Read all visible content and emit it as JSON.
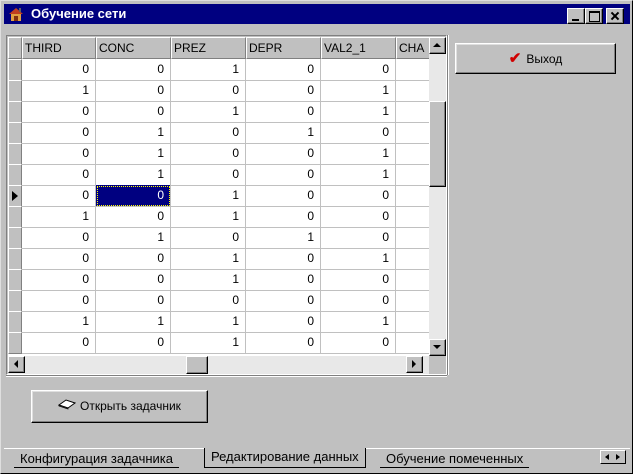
{
  "window": {
    "title": "Обучение сети"
  },
  "grid": {
    "columns": [
      "THIRD",
      "CONC",
      "PREZ",
      "DEPR",
      "VAL2_1",
      "CHA"
    ],
    "rows": [
      [
        "0",
        "0",
        "1",
        "0",
        "0"
      ],
      [
        "1",
        "0",
        "0",
        "0",
        "1"
      ],
      [
        "0",
        "0",
        "1",
        "0",
        "1"
      ],
      [
        "0",
        "1",
        "0",
        "1",
        "0"
      ],
      [
        "0",
        "1",
        "0",
        "0",
        "1"
      ],
      [
        "0",
        "1",
        "0",
        "0",
        "1"
      ],
      [
        "0",
        "0",
        "1",
        "0",
        "0"
      ],
      [
        "1",
        "0",
        "1",
        "0",
        "0"
      ],
      [
        "0",
        "1",
        "0",
        "1",
        "0"
      ],
      [
        "0",
        "0",
        "1",
        "0",
        "1"
      ],
      [
        "0",
        "0",
        "1",
        "0",
        "0"
      ],
      [
        "0",
        "0",
        "0",
        "0",
        "0"
      ],
      [
        "1",
        "1",
        "1",
        "0",
        "1"
      ],
      [
        "0",
        "0",
        "1",
        "0",
        "0"
      ]
    ],
    "current_row": 6,
    "selected_col": 1
  },
  "buttons": {
    "exit_label": "Выход",
    "open_label": "Открыть задачник"
  },
  "tabs": [
    {
      "label": "Конфигурация задачника",
      "active": false
    },
    {
      "label": "Редактирование данных",
      "active": true
    },
    {
      "label": "Обучение помеченных",
      "active": false
    }
  ]
}
